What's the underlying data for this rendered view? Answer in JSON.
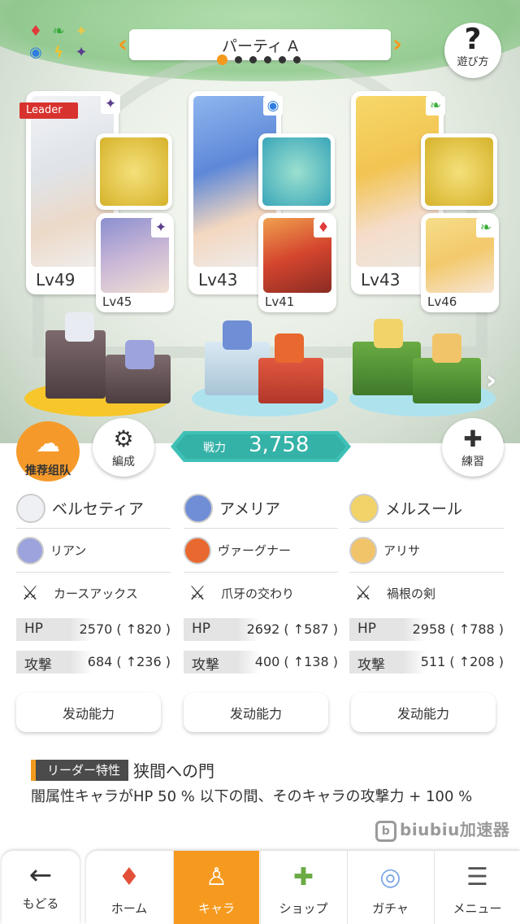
{
  "header": {
    "party_name": "パーティ A",
    "page_dots": 6,
    "active_dot": 0,
    "help_label": "遊び方",
    "help_icon": "question-mark-icon",
    "element_icons": [
      "diamond",
      "leaf",
      "star",
      "circle",
      "bolt",
      "sparkle"
    ]
  },
  "leader_tag": "Leader",
  "team": [
    {
      "main_level": "Lv49",
      "sub_level": "Lv45",
      "element_color": "#5b3f8c",
      "platform_color": "#6e5a5e",
      "platform_base": "#f6c62b"
    },
    {
      "main_level": "Lv43",
      "sub_level": "Lv41",
      "element_color": "#2f7de0",
      "platform_color": "#b8d4e8",
      "platform_base": "#8fd7e6"
    },
    {
      "main_level": "Lv43",
      "sub_level": "Lv46",
      "element_color": "#3caf3a",
      "platform_color": "#5e9c3c",
      "platform_base": "#8fd7e6"
    }
  ],
  "buttons": {
    "recommend": "推荐组队",
    "formation": "編成",
    "training": "練習"
  },
  "power": {
    "label": "戦力",
    "value": "3,758"
  },
  "members": [
    {
      "main": "ベルセティア",
      "sub": "リアン",
      "weapon": "カースアックス",
      "hp_label": "HP",
      "hp": "2570 ( ↑820 )",
      "atk_label": "攻撃",
      "atk": "684 ( ↑236 )",
      "ability": "发动能力"
    },
    {
      "main": "アメリア",
      "sub": "ヴァーグナー",
      "weapon": "爪牙の交わり",
      "hp_label": "HP",
      "hp": "2692 ( ↑587 )",
      "atk_label": "攻撃",
      "atk": "400 ( ↑138 )",
      "ability": "发动能力"
    },
    {
      "main": "メルスール",
      "sub": "アリサ",
      "weapon": "禍根の剣",
      "hp_label": "HP",
      "hp": "2958 ( ↑788 )",
      "atk_label": "攻撃",
      "atk": "511 ( ↑208 )",
      "ability": "发动能力"
    }
  ],
  "leader_trait": {
    "tag": "リーダー特性",
    "name": "狭間への門",
    "description": "闇属性キャラがHP 50 % 以下の間、そのキャラの攻撃力 + 100 %"
  },
  "watermark": "biubiu加速器",
  "nav": {
    "back": "もどる",
    "tabs": [
      "ホーム",
      "キャラ",
      "ショップ",
      "ガチャ",
      "メニュー"
    ],
    "active": "キャラ"
  }
}
